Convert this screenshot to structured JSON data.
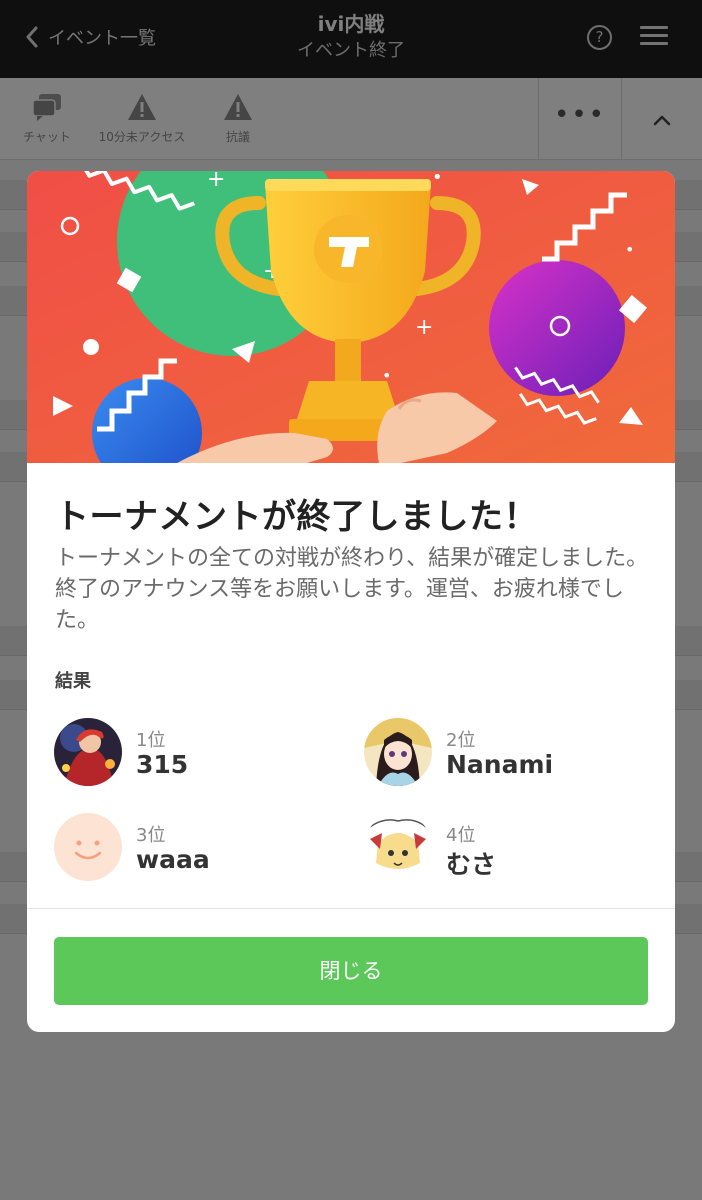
{
  "header": {
    "back_label": "イベント一覧",
    "title": "ivi内戦",
    "subtitle": "イベント終了",
    "help_glyph": "?"
  },
  "toolbar": {
    "items": [
      {
        "label": "チャット",
        "icon": "chat-icon"
      },
      {
        "label": "10分未アクセス",
        "icon": "warning-icon"
      },
      {
        "label": "抗議",
        "icon": "warning-icon"
      }
    ],
    "more_glyph": "•••"
  },
  "modal": {
    "heading": "トーナメントが終了しました！",
    "description": "トーナメントの全ての対戦が終わり、結果が確定しました。終了のアナウンス等をお願いします。運営、お疲れ様でした。",
    "results_label": "結果",
    "results": [
      {
        "rank": "1位",
        "name": "315"
      },
      {
        "rank": "2位",
        "name": "Nanami"
      },
      {
        "rank": "3位",
        "name": "waaa"
      },
      {
        "rank": "4位",
        "name": "むさ"
      }
    ],
    "close_label": "閉じる"
  },
  "colors": {
    "header_bg": "#1f1f1f",
    "accent_green": "#5cc85a",
    "banner_red": "#ee4a3f",
    "trophy_gold": "#f6c12e"
  }
}
